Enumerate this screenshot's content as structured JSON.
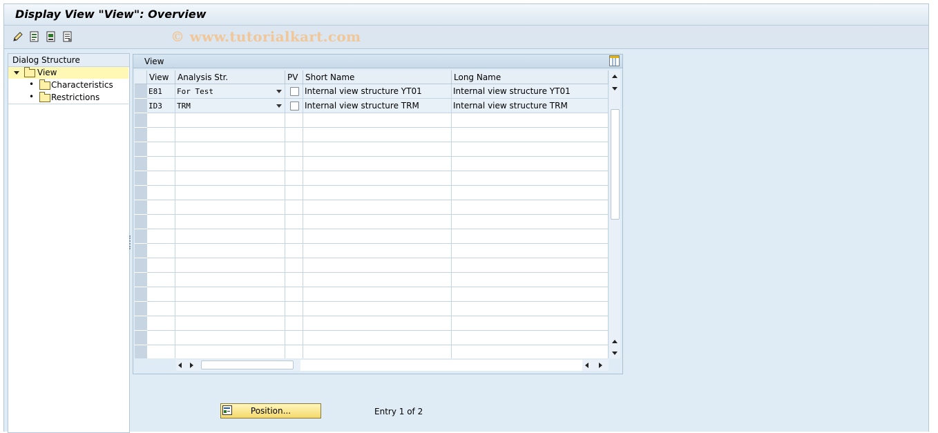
{
  "window": {
    "title": "Display View \"View\": Overview"
  },
  "toolbar": {
    "icons": [
      "edit-pencil-icon",
      "select-all-icon",
      "deselect-icon",
      "details-icon"
    ],
    "watermark": "© www.tutorialkart.com"
  },
  "dialog_structure": {
    "header": "Dialog Structure",
    "items": [
      {
        "label": "View",
        "selected": true,
        "expanded": true
      },
      {
        "label": "Characteristics"
      },
      {
        "label": "Restrictions"
      }
    ]
  },
  "table": {
    "title": "View",
    "columns": [
      "View",
      "Analysis Str.",
      "PV",
      "Short Name",
      "Long Name"
    ],
    "rows": [
      {
        "view": "E81",
        "analysis": "For Test",
        "pv": false,
        "short": "Internal view structure YT01",
        "long": "Internal view structure YT01"
      },
      {
        "view": "ID3",
        "analysis": "TRM",
        "pv": false,
        "short": "Internal view structure TRM",
        "long": "Internal view structure TRM"
      }
    ]
  },
  "footer": {
    "position_button": "Position...",
    "entry_text": "Entry 1 of 2"
  },
  "colors": {
    "accent_yellow": "#fef8b4",
    "panel_bg": "#dfebf5"
  }
}
